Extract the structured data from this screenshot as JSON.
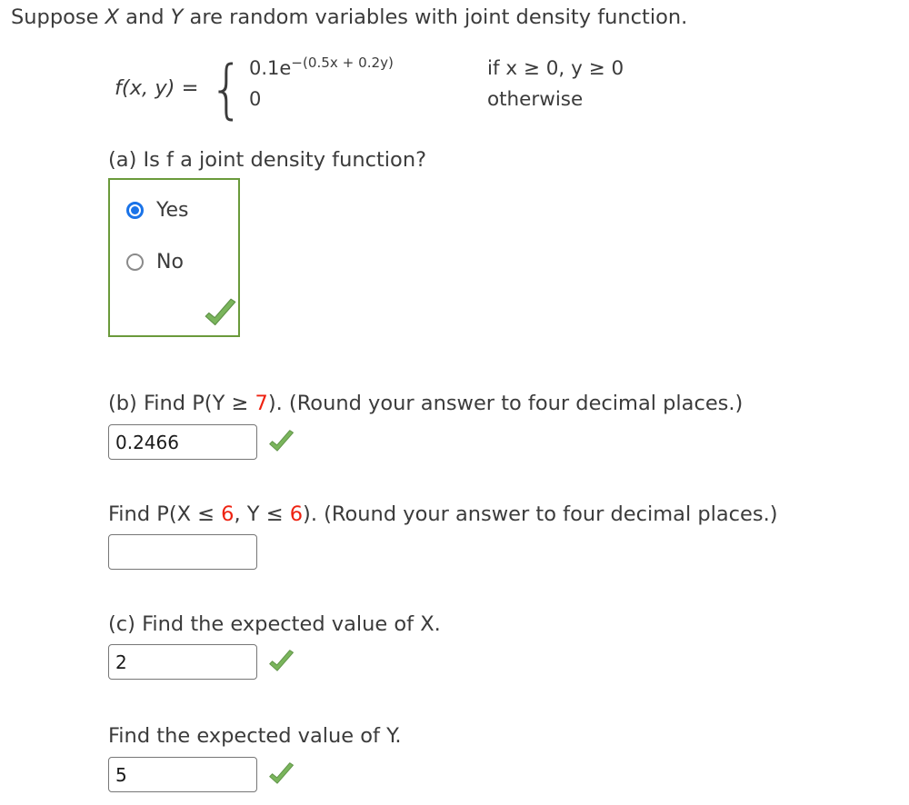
{
  "problem": {
    "intro_prefix": "Suppose ",
    "intro_var1": "X",
    "intro_mid": " and ",
    "intro_var2": "Y",
    "intro_suffix": " are random variables with joint density function."
  },
  "formula": {
    "lhs": "f(x, y) =",
    "case1_value_base": "0.1e",
    "case1_value_exponent": "−(0.5x + 0.2y)",
    "case1_condition": "if x ≥ 0, y ≥ 0",
    "case2_value": "0",
    "case2_condition": "otherwise"
  },
  "parts": {
    "a": {
      "label": "(a) Is f a joint density function?",
      "options": [
        {
          "label": "Yes",
          "selected": true
        },
        {
          "label": "No",
          "selected": false
        }
      ],
      "status": "correct",
      "status_icon": "green-check-icon",
      "box_border_color": "#6a9a3b"
    },
    "b": {
      "label_prefix": "(b) Find P(Y ≥ ",
      "label_number": "7",
      "label_suffix": "). (Round your answer to four decimal places.)",
      "input_value": "0.2466",
      "input_placeholder": "",
      "status": "correct",
      "status_icon": "green-check-icon"
    },
    "b2": {
      "label_prefix": "Find P(X ≤ ",
      "label_number1": "6",
      "label_middle": ", Y ≤ ",
      "label_number2": "6",
      "label_suffix": "). (Round your answer to four decimal places.)",
      "input_value": "",
      "input_placeholder": "",
      "status": "unanswered"
    },
    "c": {
      "label": "(c) Find the expected value of X.",
      "input_value": "2",
      "input_placeholder": "",
      "status": "correct",
      "status_icon": "green-check-icon"
    },
    "d": {
      "label": "Find the expected value of Y.",
      "input_value": "5",
      "input_placeholder": "",
      "status": "correct",
      "status_icon": "green-check-icon"
    }
  },
  "colors": {
    "text": "#3b3b3b",
    "highlight_number": "#ee2211",
    "check_green": "#7ab55c",
    "radio_selected_blue": "#1a73e8",
    "input_border": "#767676",
    "correct_box_border": "#6a9a3b"
  }
}
